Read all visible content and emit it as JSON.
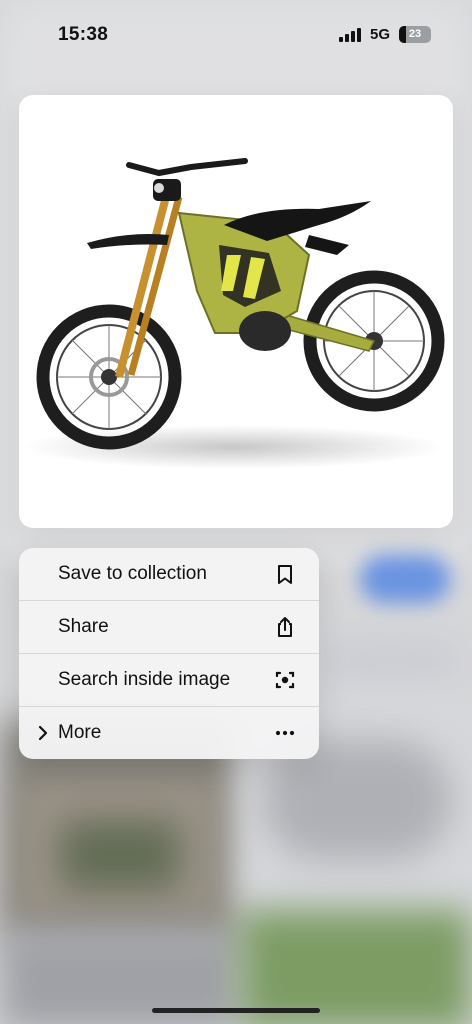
{
  "status_bar": {
    "time": "15:38",
    "network": "5G",
    "battery_level": "23",
    "signal_bars": 4
  },
  "image_card": {
    "subject_icon": "electric-dirt-bike-photo",
    "accent_color": "#a8b23c"
  },
  "menu": {
    "items": [
      {
        "label": "Save to collection",
        "icon": "bookmark-icon"
      },
      {
        "label": "Share",
        "icon": "share-icon"
      },
      {
        "label": "Search inside image",
        "icon": "visual-search-icon"
      },
      {
        "label": "More",
        "icon": "ellipsis-icon",
        "leading_icon": "chevron-right-icon"
      }
    ]
  }
}
